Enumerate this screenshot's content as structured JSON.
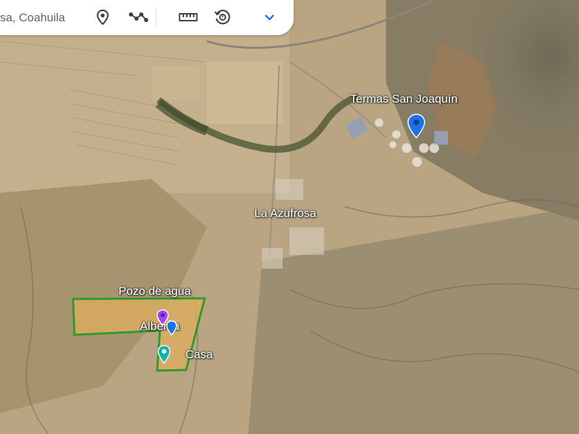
{
  "search": {
    "query": "sa, Coahuila"
  },
  "toolbar": {
    "icons": [
      "location-pin-icon",
      "route-line-icon",
      "ruler-icon",
      "history-icon",
      "chevron-down-icon"
    ]
  },
  "places": [
    {
      "name": "Termas San Joaquín",
      "pin_color": "#1a73e8"
    },
    {
      "name": "La Azufrosa"
    },
    {
      "name": "Pozo de agua",
      "pin_color": "#a142f4"
    },
    {
      "name": "Alberca",
      "pin_color": "#1a73e8"
    },
    {
      "name": "Casa",
      "pin_color": "#12b5a5"
    }
  ],
  "polygon": {
    "stroke": "#2e9a2e",
    "fill": "#e0ae5c"
  }
}
